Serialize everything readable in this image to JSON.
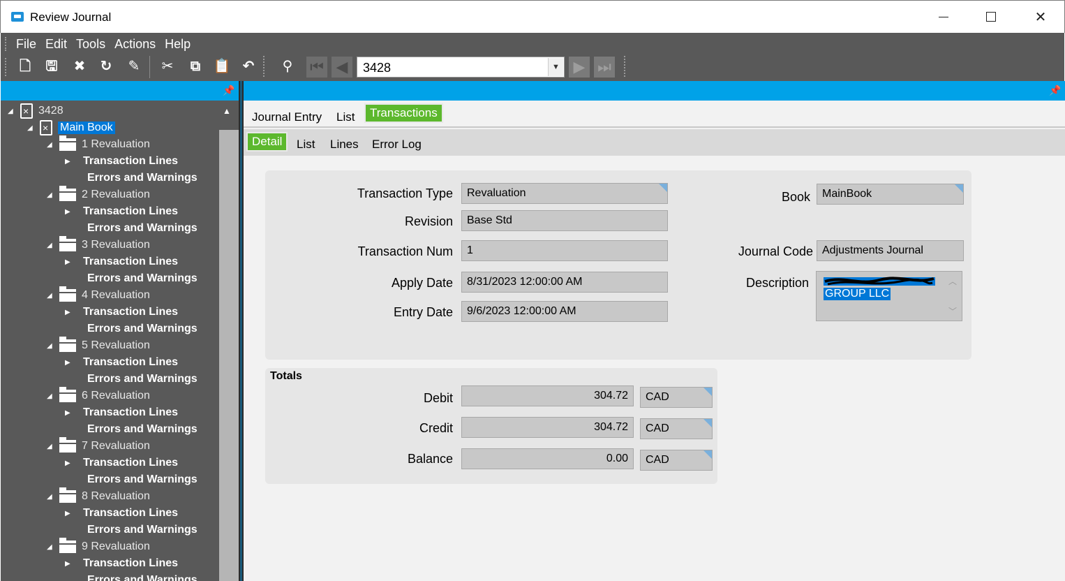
{
  "window": {
    "title": "Review Journal"
  },
  "menu": [
    "File",
    "Edit",
    "Tools",
    "Actions",
    "Help"
  ],
  "toolbar": {
    "record_value": "3428",
    "icons": [
      "new-icon",
      "save-icon",
      "delete-icon",
      "refresh-icon",
      "clear-icon",
      "cut-icon",
      "copy-icon",
      "paste-icon",
      "undo-icon",
      "search-icon",
      "first-icon",
      "prev-icon",
      "next-icon",
      "last-icon"
    ]
  },
  "tree": {
    "root": "3428",
    "book": "Main Book",
    "groups": [
      {
        "label": "1 Revaluation",
        "child1": "Transaction Lines",
        "child2": "Errors and Warnings"
      },
      {
        "label": "2 Revaluation",
        "child1": "Transaction Lines",
        "child2": "Errors and Warnings"
      },
      {
        "label": "3 Revaluation",
        "child1": "Transaction Lines",
        "child2": "Errors and Warnings"
      },
      {
        "label": "4 Revaluation",
        "child1": "Transaction Lines",
        "child2": "Errors and Warnings"
      },
      {
        "label": "5 Revaluation",
        "child1": "Transaction Lines",
        "child2": "Errors and Warnings"
      },
      {
        "label": "6 Revaluation",
        "child1": "Transaction Lines",
        "child2": "Errors and Warnings"
      },
      {
        "label": "7 Revaluation",
        "child1": "Transaction Lines",
        "child2": "Errors and Warnings"
      },
      {
        "label": "8 Revaluation",
        "child1": "Transaction Lines",
        "child2": "Errors and Warnings"
      },
      {
        "label": "9 Revaluation",
        "child1": "Transaction Lines",
        "child2": "Errors and Warnings"
      }
    ]
  },
  "tabs": {
    "top": [
      "Journal Entry",
      "List",
      "Transactions"
    ],
    "sub": [
      "Detail",
      "List",
      "Lines",
      "Error Log"
    ]
  },
  "detail": {
    "transaction_type_label": "Transaction Type",
    "transaction_type": "Revaluation",
    "revision_label": "Revision",
    "revision": "Base Std",
    "transaction_num_label": "Transaction Num",
    "transaction_num": "1",
    "apply_date_label": "Apply Date",
    "apply_date": "8/31/2023 12:00:00 AM",
    "entry_date_label": "Entry Date",
    "entry_date": "9/6/2023 12:00:00 AM",
    "book_label": "Book",
    "book": "MainBook",
    "journal_code_label": "Journal Code",
    "journal_code": "Adjustments Journal",
    "description_label": "Description",
    "description_visible": "GROUP LLC"
  },
  "totals": {
    "title": "Totals",
    "debit_label": "Debit",
    "debit": "304.72",
    "debit_currency": "CAD",
    "credit_label": "Credit",
    "credit": "304.72",
    "credit_currency": "CAD",
    "balance_label": "Balance",
    "balance": "0.00",
    "balance_currency": "CAD"
  },
  "colors": {
    "accent_blue": "#00a2e8",
    "active_tab_green": "#5cb82d",
    "toolbar_gray": "#595959",
    "selection_blue": "#0078d7"
  }
}
